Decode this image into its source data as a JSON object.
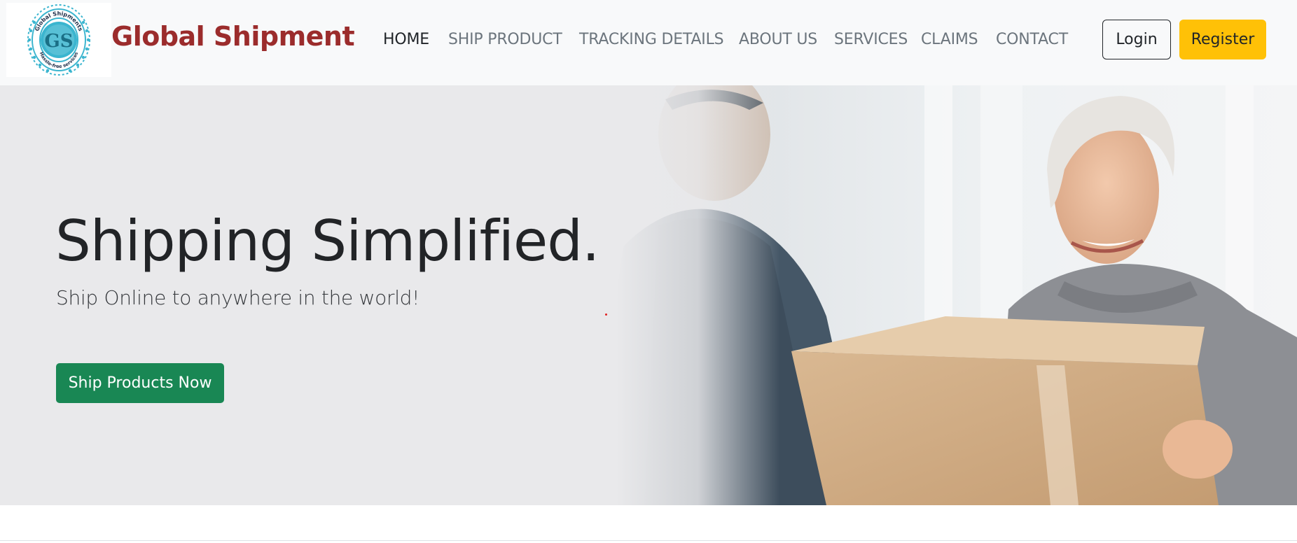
{
  "brand": {
    "name": "Global Shipment",
    "logo_monogram": "GS",
    "logo_ring_top": "Global Shipments",
    "logo_ring_bottom": "Hassle-free services",
    "brand_color": "#9b2c2c",
    "logo_color": "#3bb5cf"
  },
  "nav": {
    "items": [
      {
        "label": "HOME",
        "active": true
      },
      {
        "label": "SHIP PRODUCT",
        "active": false
      },
      {
        "label": "TRACKING DETAILS",
        "active": false
      },
      {
        "label": "ABOUT US",
        "active": false
      },
      {
        "label": "SERVICES",
        "active": false
      },
      {
        "label": "CLAIMS",
        "active": false
      },
      {
        "label": "CONTACT",
        "active": false
      }
    ],
    "login_label": "Login",
    "register_label": "Register"
  },
  "hero": {
    "title": "Shipping Simplified.",
    "subtitle": "Ship Online to anywhere in the world!",
    "cta_label": "Ship Products Now",
    "cta_color": "#198754"
  },
  "colors": {
    "navbar_bg": "#f8f9fa",
    "hero_bg": "#e9e9eb",
    "register_bg": "#ffc107"
  }
}
